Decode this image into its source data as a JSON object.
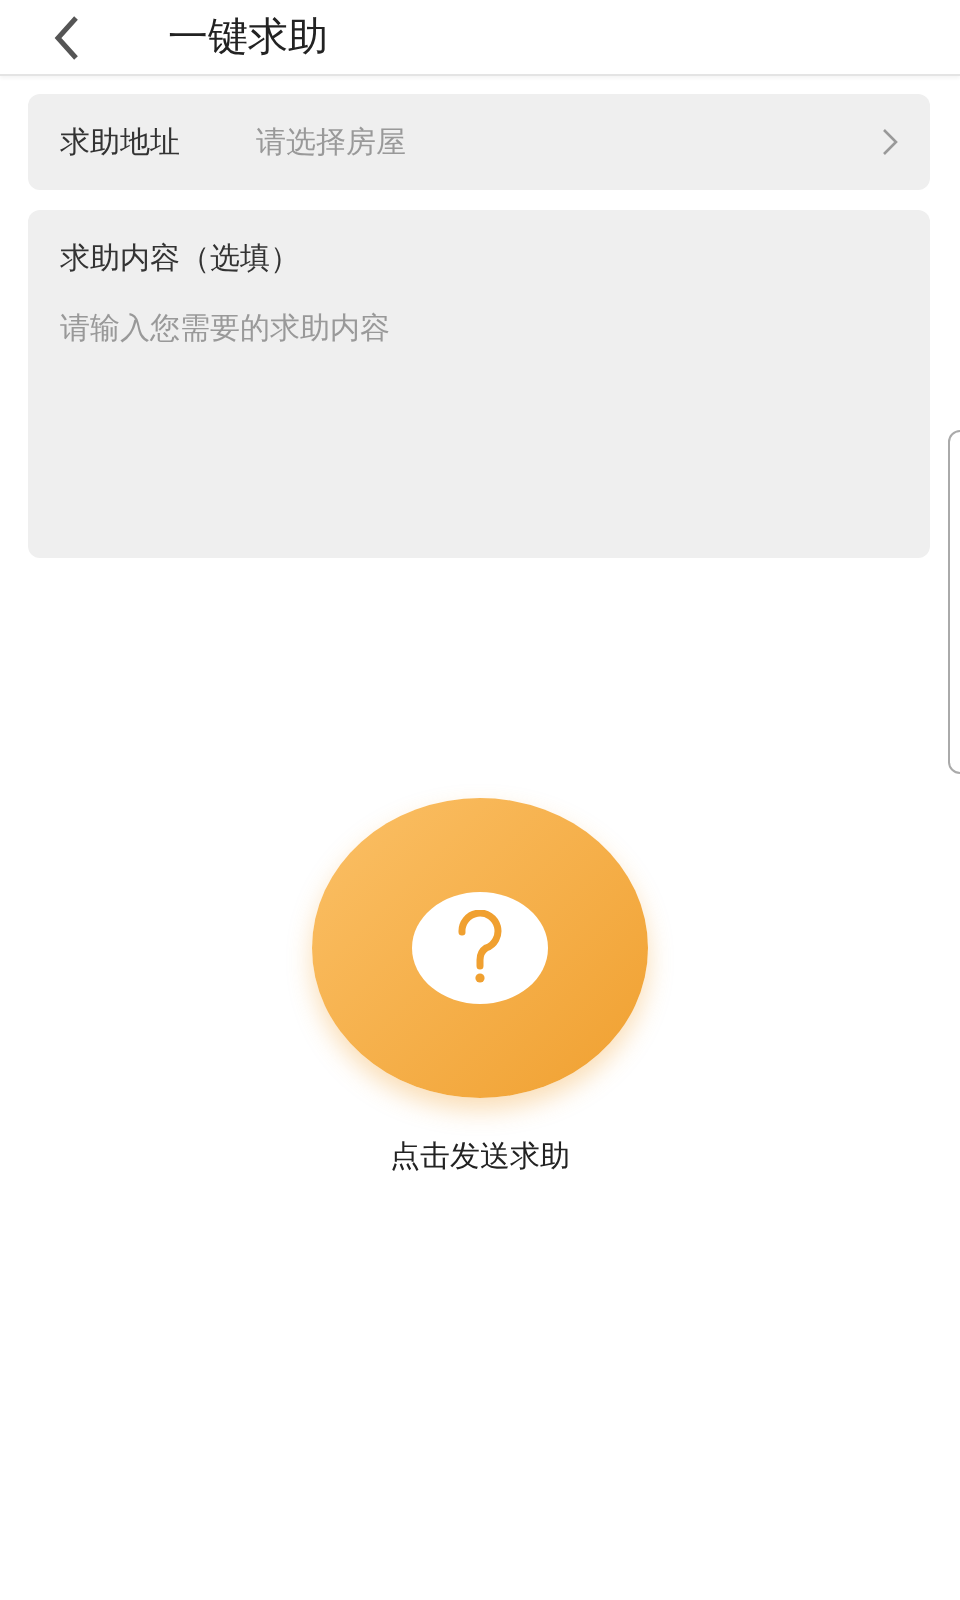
{
  "header": {
    "title": "一键求助"
  },
  "address": {
    "label": "求助地址",
    "placeholder": "请选择房屋"
  },
  "content": {
    "label": "求助内容（选填）",
    "placeholder": "请输入您需要的求助内容"
  },
  "help_button": {
    "label": "点击发送求助"
  }
}
